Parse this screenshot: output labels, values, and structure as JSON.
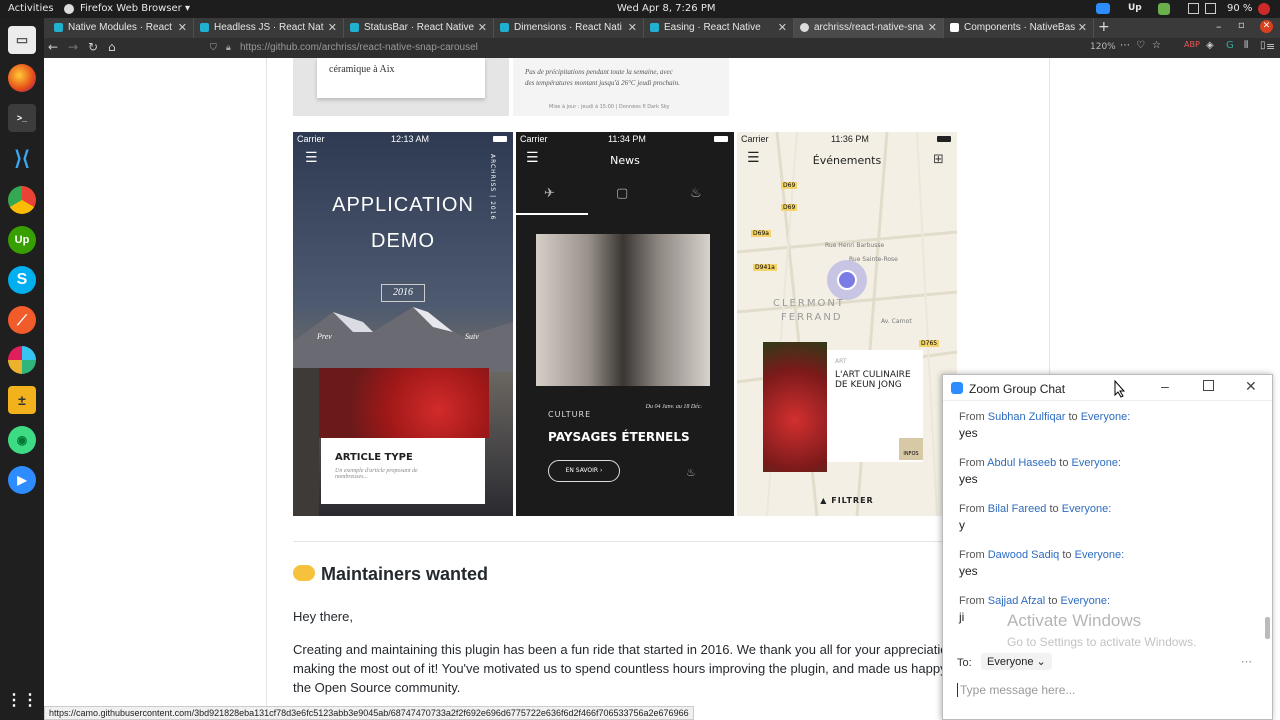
{
  "topbar": {
    "activities": "Activities",
    "browser_menu": "Firefox Web Browser ▾",
    "clock": "Wed Apr 8,  7:26 PM",
    "battery": "90 %"
  },
  "tabs": [
    {
      "label": "Native Modules · React"
    },
    {
      "label": "Headless JS · React Nat"
    },
    {
      "label": "StatusBar · React Native"
    },
    {
      "label": "Dimensions · React Nati"
    },
    {
      "label": "Easing · React Native"
    },
    {
      "label": "archriss/react-native-sna"
    },
    {
      "label": "Components · NativeBas"
    }
  ],
  "address": {
    "url": "https://github.com/archriss/react-native-snap-carousel",
    "zoom": "120%"
  },
  "top_cards": {
    "left_text": "céramique à Aix",
    "right_text_1": "Pas de précipitations pendant toute la semaine, avec",
    "right_text_2": "des températures montant jusqu'à 26°C jeudi prochain.",
    "right_small": "Mise à jour : jeudi à 15:00 | Données fl Dark Sky"
  },
  "phone1": {
    "carrier": "Carrier",
    "time": "12:13 AM",
    "title_line1": "APPLICATION",
    "title_line2": "DEMO",
    "year": "2016",
    "vertical": "ARCHRISS | 2016",
    "prev": "Prev",
    "next": "Suiv",
    "card_title": "ARTICLE TYPE",
    "card_sub": "Un exemple d'article proposant de nombreuses..."
  },
  "phone2": {
    "carrier": "Carrier",
    "time": "11:34 PM",
    "title": "News",
    "category": "CULTURE",
    "date": "Du 04 Janv. au 18 Déc.",
    "headline": "PAYSAGES ÉTERNELS",
    "button": "EN SAVOIR ›"
  },
  "phone3": {
    "carrier": "Carrier",
    "time": "11:36 PM",
    "title": "Événements",
    "city_1": "CLERMONT",
    "city_2": "FERRAND",
    "street_1": "Rue Henri Barbusse",
    "street_2": "Av. Carnot",
    "street_3": "Rue Sainte-Rose",
    "card_title": "L'ART CULINAIRE DE KEUN JONG",
    "card_tag": "ART",
    "infos": "INFOS",
    "filter": "▲  FILTRER",
    "roads": [
      "D69",
      "D69",
      "D69a",
      "D941a",
      "D765"
    ]
  },
  "article": {
    "heading": "Maintainers wanted",
    "hello": "Hey there,",
    "para_1": "Creating and maintaining this plugin has been a fun ride that started in 2016. We thank you all for your appreciatio",
    "para_2": "making the most out of it! You've motivated us to spend countless hours improving the plugin, and made us happy t",
    "para_3": "the Open Source community."
  },
  "status_url": "https://camo.githubusercontent.com/3bd921828eba131cf78d3e6fc5123abb3e9045ab/68747470733a2f2f692e696d6775722e636f6d2f466f706533756a2e676966",
  "chat": {
    "title": "Zoom Group Chat",
    "messages": [
      {
        "from": "From",
        "name": "Subhan Zulfiqar",
        "to": "to",
        "target": "Everyone:",
        "text": "yes"
      },
      {
        "from": "From",
        "name": "Abdul Haseeb",
        "to": "to",
        "target": "Everyone:",
        "text": "yes"
      },
      {
        "from": "From",
        "name": "Bilal Fareed",
        "to": "to",
        "target": "Everyone:",
        "text": "y"
      },
      {
        "from": "From",
        "name": "Dawood Sadiq",
        "to": "to",
        "target": "Everyone:",
        "text": "yes"
      },
      {
        "from": "From",
        "name": "Sajjad Afzal",
        "to": "to",
        "target": "Everyone:",
        "text": "ji"
      }
    ],
    "watermark_1": "Activate Windows",
    "watermark_2": "Go to Settings to activate Windows.",
    "to_label": "To:",
    "to_value": "Everyone ⌄",
    "placeholder": "Type message here..."
  },
  "colors": {
    "link": "#2d6cc0",
    "text": "#24292e",
    "dock": "#1f1f1f"
  }
}
